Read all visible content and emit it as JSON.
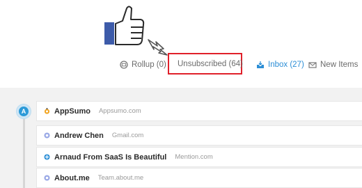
{
  "tabs": [
    {
      "label": "Rollup (0)",
      "icon": "rollup-icon"
    },
    {
      "label": "Unsubscribed (64)",
      "icon": "unsubscribed-icon"
    },
    {
      "label": "Inbox (27)",
      "icon": "inbox-icon"
    },
    {
      "label": "New Items",
      "icon": "envelope-icon"
    }
  ],
  "timeline": {
    "letter": "A"
  },
  "senders": [
    {
      "name": "AppSumo",
      "domain": "Appsumo.com",
      "icon": "appsumo-icon"
    },
    {
      "name": "Andrew Chen",
      "domain": "Gmail.com",
      "icon": "gmail-icon"
    },
    {
      "name": "Arnaud From SaaS Is Beautiful",
      "domain": "Mention.com",
      "icon": "mention-icon"
    },
    {
      "name": "About.me",
      "domain": "Team.about.me",
      "icon": "aboutme-icon"
    }
  ],
  "colors": {
    "accent": "#2c8ed6",
    "highlight_border": "#e0202a",
    "thumb_blue": "#3d5ba9",
    "band": "#f2f2f2"
  }
}
